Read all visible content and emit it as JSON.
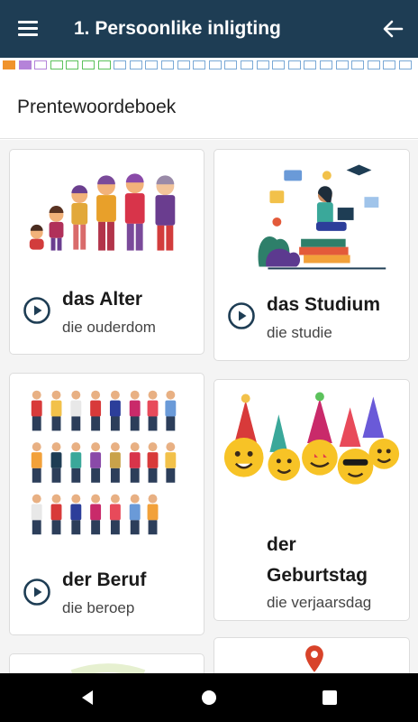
{
  "appbar": {
    "title": "1. Persoonlike inligting",
    "menu_icon": "hamburger-menu-icon",
    "back_icon": "arrow-left-icon"
  },
  "progress": {
    "total_segments": 26,
    "segment_colors": [
      "#f0932b",
      "#b583d9",
      "#b583d9",
      "#5cc25c",
      "#5cc25c",
      "#5cc25c",
      "#5cc25c"
    ],
    "default_segment_color": "#7aa9d6",
    "filled_segments": 2
  },
  "section": {
    "title": "Prentewoordeboek"
  },
  "cards": [
    {
      "word": "das Alter",
      "translation": "die ouderdom",
      "illustration": "family-ages-illustration"
    },
    {
      "word": "das Studium",
      "translation": "die studie",
      "illustration": "student-laptop-illustration"
    },
    {
      "word": "der Beruf",
      "translation": "die beroep",
      "illustration": "professions-illustration"
    },
    {
      "word": "der Geburtstag",
      "translation": "die verjaarsdag",
      "illustration": "party-emoji-illustration"
    }
  ],
  "navbar": {
    "back": "nav-back-icon",
    "home": "nav-home-icon",
    "recents": "nav-recents-icon"
  }
}
